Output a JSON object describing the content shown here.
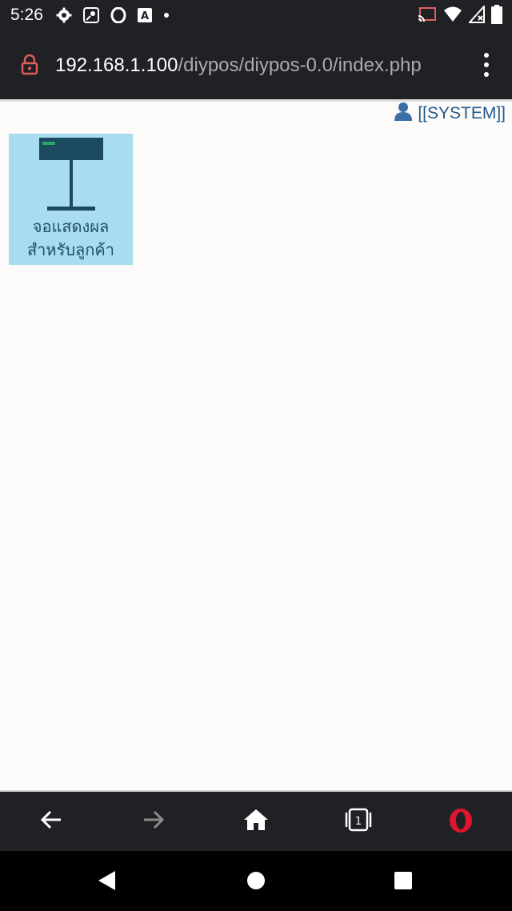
{
  "status_bar": {
    "time": "5:26",
    "left_icons": [
      "gear-icon",
      "map-pin-icon",
      "opera-o-icon",
      "a-square-icon",
      "dot-icon"
    ],
    "right_icons": [
      "cast-icon",
      "wifi-icon",
      "cellular-icon",
      "battery-icon"
    ]
  },
  "url_bar": {
    "host": "192.168.1.100",
    "path": "/diypos/diypos-0.0/index.php",
    "lock_color": "#e05d5d"
  },
  "page": {
    "user_label": "[[SYSTEM]]",
    "tiles": [
      {
        "label_line1": "จอแสดงผล",
        "label_line2": "สำหรับลูกค้า",
        "icon": "customer-display-icon"
      }
    ]
  },
  "toolbar": {
    "buttons": [
      "back-icon",
      "forward-icon",
      "home-icon",
      "tabs-icon",
      "opera-icon"
    ],
    "tab_count": "1",
    "opera_color": "#e0152d"
  },
  "nav_bar": {
    "buttons": [
      "nav-back-icon",
      "nav-home-icon",
      "nav-recents-icon"
    ]
  }
}
